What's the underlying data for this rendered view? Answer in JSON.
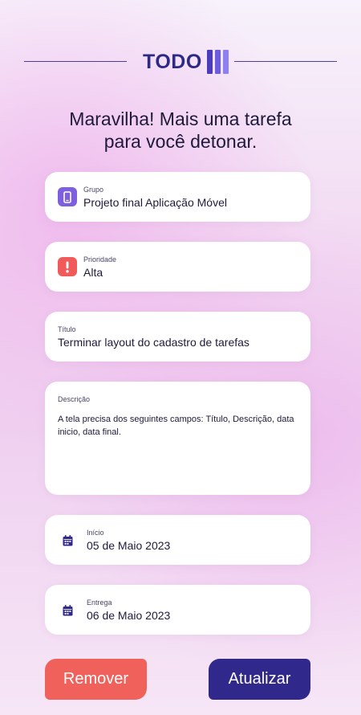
{
  "header": {
    "logo_text": "TODO"
  },
  "heading": {
    "line1": "Maravilha! Mais uma tarefa",
    "line2": "para você detonar."
  },
  "fields": {
    "group": {
      "label": "Grupo",
      "value": "Projeto final Aplicação Móvel",
      "icon": "smartphone-icon"
    },
    "priority": {
      "label": "Prioridade",
      "value": "Alta",
      "icon": "exclamation-icon"
    },
    "title": {
      "label": "Título",
      "value": "Terminar layout do cadastro de tarefas"
    },
    "description": {
      "label": "Descrição",
      "value": "A tela precisa dos seguintes campos: Título, Descrição, data inicio, data final."
    },
    "start": {
      "label": "Início",
      "value": "05 de Maio 2023",
      "icon": "calendar-icon"
    },
    "due": {
      "label": "Entrega",
      "value": "06 de Maio 2023",
      "icon": "calendar-icon"
    }
  },
  "actions": {
    "remove_label": "Remover",
    "update_label": "Atualizar"
  },
  "colors": {
    "primary": "#30288a",
    "danger": "#f1615c",
    "group_icon_bg": "#7d5fe0",
    "priority_icon_bg": "#f05a5a"
  }
}
